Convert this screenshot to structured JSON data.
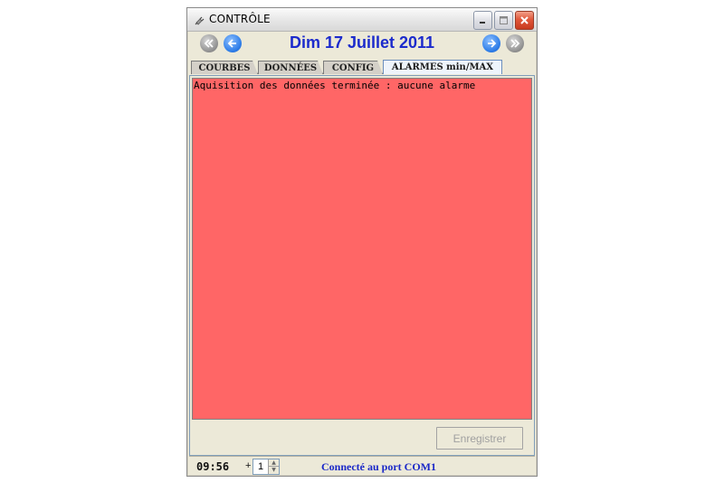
{
  "window": {
    "title": "CONTRÔLE"
  },
  "nav": {
    "date": "Dim 17 Juillet 2011"
  },
  "tabs": [
    {
      "label": "COURBES",
      "active": false
    },
    {
      "label": "DONNÉES",
      "active": false
    },
    {
      "label": "CONFIG",
      "active": false
    },
    {
      "label": "ALARMES min/MAX",
      "active": true
    }
  ],
  "panel": {
    "message": "Aquisition des données terminée : aucune alarme",
    "save_label": "Enregistrer",
    "background": "#ff6666"
  },
  "status": {
    "time": "09:56",
    "plus": "+",
    "spinner_value": "1",
    "connection": "Connecté au port COM1"
  },
  "icons": {
    "first": "double-chevron-left-icon",
    "prev": "arrow-left-icon",
    "next": "arrow-right-icon",
    "last": "double-chevron-right-icon"
  },
  "colors": {
    "date": "#1c2bcc",
    "connection": "#1a28c8",
    "alarm_bg": "#ff6666"
  }
}
